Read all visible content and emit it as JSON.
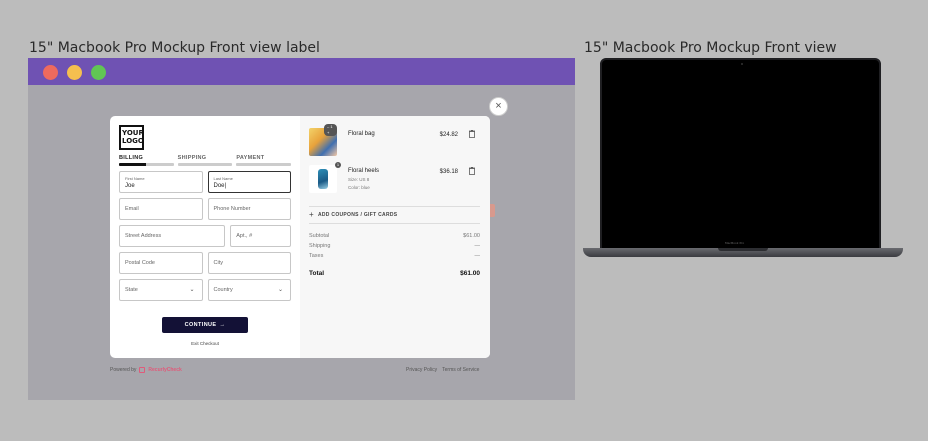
{
  "canvas": {
    "left_label": "15\" Macbook Pro Mockup Front view label",
    "right_label": "15\" Macbook Pro Mockup Front view"
  },
  "window": {
    "traffic_lights": [
      "#ee6a5e",
      "#f5bf4f",
      "#61c554"
    ],
    "titlebar_color": "#6f52b3"
  },
  "checkout": {
    "close_symbol": "×",
    "logo": "YOUR LOGO",
    "steps": [
      {
        "label": "BILLING",
        "progress": 0.5
      },
      {
        "label": "SHIPPING",
        "progress": 0
      },
      {
        "label": "PAYMENT",
        "progress": 0
      }
    ],
    "fields": {
      "first_name": {
        "label": "First Name",
        "value": "Joe"
      },
      "last_name": {
        "label": "Last Name",
        "value": "Doe|"
      },
      "email": "Email",
      "phone": "Phone Number",
      "street": "Street Address",
      "apt": "Apt., #",
      "postal": "Postal Code",
      "city": "City",
      "state": "State",
      "country": "Country"
    },
    "continue_label": "CONTINUE",
    "continue_arrow": "→",
    "exit_label": "Exit Checkout",
    "items": [
      {
        "name": "Floral bag",
        "price": "$24.82",
        "qty_badge": "– 1 +"
      },
      {
        "name": "Floral heels",
        "price": "$36.18",
        "size": "Size: US 8",
        "color": "Color: blue",
        "count_badge": "1"
      }
    ],
    "coupon_label": "ADD COUPONS / GIFT CARDS",
    "summary": {
      "subtotal_label": "Subtotal",
      "subtotal": "$61.00",
      "shipping_label": "Shipping",
      "shipping": "—",
      "taxes_label": "Taxes",
      "taxes": "—",
      "total_label": "Total",
      "total": "$61.00"
    },
    "footer": {
      "powered_by": "Powered by",
      "brand": "RecurlyCheck",
      "privacy": "Privacy Policy",
      "terms": "Terms of Service"
    }
  },
  "laptop": {
    "model_text": "MacBook Pro"
  }
}
